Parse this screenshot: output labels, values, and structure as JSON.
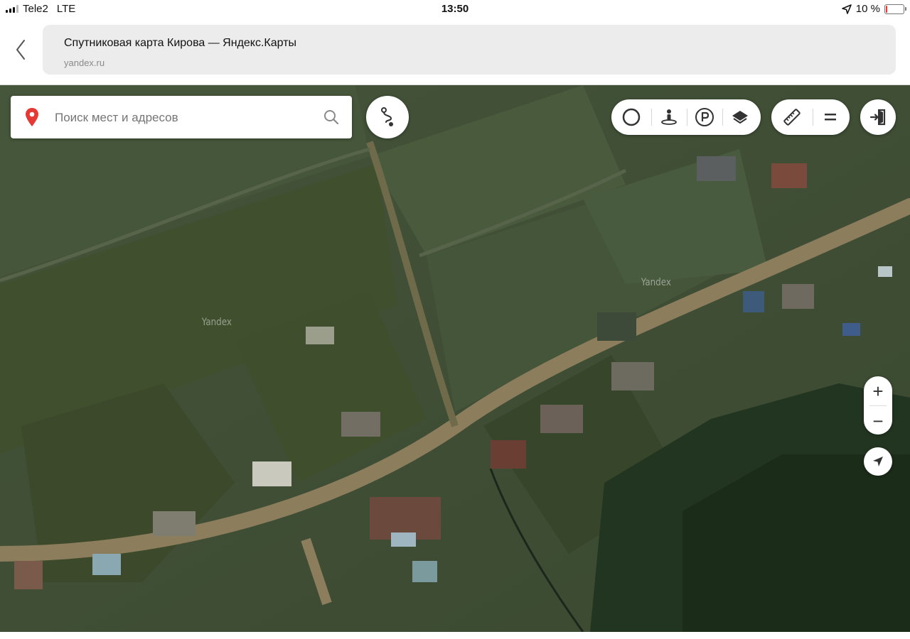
{
  "status_bar": {
    "carrier": "Tele2",
    "network": "LTE",
    "time": "13:50",
    "battery_text": "10 %",
    "battery_level": 0.1,
    "battery_color": "#e53935",
    "icons": [
      "signal-icon",
      "location-arrow-icon",
      "battery-icon"
    ]
  },
  "browser": {
    "page_title": "Спутниковая карта Кирова — Яндекс.Карты",
    "domain": "yandex.ru",
    "icons": [
      "back-chevron-icon"
    ]
  },
  "map": {
    "search": {
      "placeholder": "Поиск мест и адресов",
      "icons": [
        "location-pin-icon",
        "search-icon"
      ]
    },
    "watermarks": [
      "Yandex",
      "Yandex"
    ],
    "controls": {
      "route": "route-icon",
      "layers_group": [
        "traffic-icon",
        "panorama-icon",
        "parking-icon",
        "layers-icon"
      ],
      "tools_group": [
        "ruler-icon",
        "menu-icon"
      ],
      "login": "login-icon",
      "zoom_in": "+",
      "zoom_out": "−",
      "locate": "locate-arrow-icon"
    },
    "colors": {
      "pin": "#e53935",
      "grass": "#3b4a2c",
      "road": "#8c7d5c",
      "forest": "#1f3119"
    }
  }
}
